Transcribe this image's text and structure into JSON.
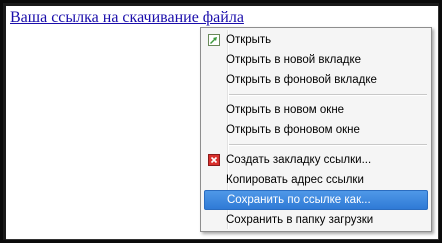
{
  "link": {
    "text": "Ваша ссылка на скачивание файла"
  },
  "context_menu": {
    "items": [
      {
        "label": "Открыть",
        "icon": "open-icon"
      },
      {
        "label": "Открыть в новой вкладке"
      },
      {
        "label": "Открыть в фоновой вкладке"
      },
      {
        "label": "Открыть в новом окне"
      },
      {
        "label": "Открыть в фоновом окне"
      },
      {
        "label": "Создать закладку ссылки...",
        "icon": "bookmark-icon"
      },
      {
        "label": "Копировать адрес ссылки"
      },
      {
        "label": "Сохранить по ссылке как...",
        "highlighted": true
      },
      {
        "label": "Сохранить в папку загрузки"
      }
    ]
  },
  "colors": {
    "link": "#1a0dab",
    "highlight": "#3a86dc",
    "menu_bg": "#f5f5f5"
  }
}
